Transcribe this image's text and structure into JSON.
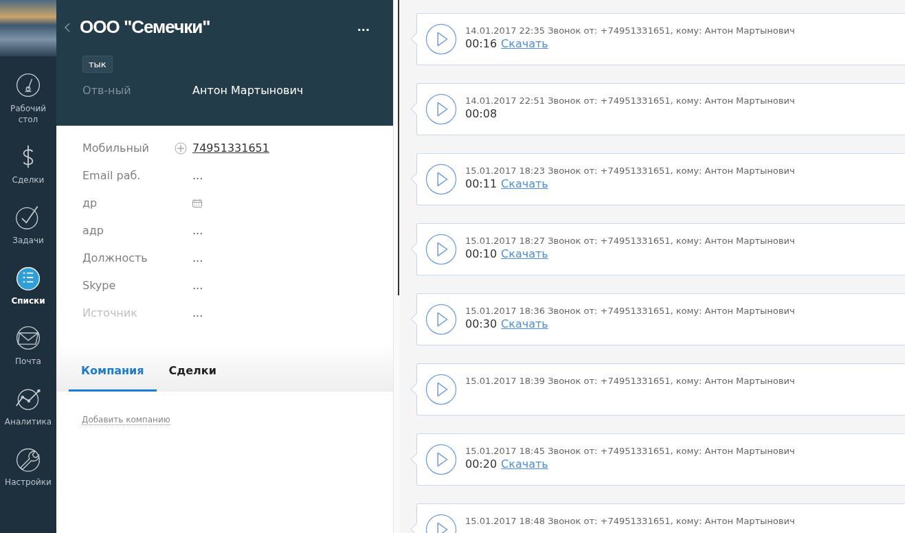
{
  "nav": [
    {
      "label": "Рабочий стол",
      "selected": false
    },
    {
      "label": "Сделки",
      "selected": false
    },
    {
      "label": "Задачи",
      "selected": false
    },
    {
      "label": "Списки",
      "selected": true
    },
    {
      "label": "Почта",
      "selected": false
    },
    {
      "label": "Аналитика",
      "selected": false
    },
    {
      "label": "Настройки",
      "selected": false
    }
  ],
  "card": {
    "title": "ООО \"Семечки\"",
    "more": "...",
    "tag": "тык",
    "owner_label": "Отв-ный",
    "owner": "Антон Мартынович",
    "fields": [
      {
        "kind": "phone",
        "label": "Мобильный",
        "value": "74951331651",
        "dim": false
      },
      {
        "kind": "text",
        "label": "Email раб.",
        "value": "...",
        "dim": false
      },
      {
        "kind": "date",
        "label": "др",
        "dim": false
      },
      {
        "kind": "text",
        "label": "адр",
        "value": "...",
        "dim": false
      },
      {
        "kind": "text",
        "label": "Должность",
        "value": "...",
        "dim": false
      },
      {
        "kind": "text",
        "label": "Skype",
        "value": "...",
        "dim": false
      },
      {
        "kind": "text",
        "label": "Источник",
        "value": "...",
        "dim": true
      }
    ],
    "tabs": [
      {
        "label": "Компания",
        "selected": true
      },
      {
        "label": "Сделки",
        "selected": false
      }
    ],
    "add_link": "Добавить компанию"
  },
  "calls": [
    {
      "header": "14.01.2017 22:35 Звонок от: +74951331651, кому: Антон Мартынович",
      "duration": "00:16",
      "link": "Скачать"
    },
    {
      "header": "14.01.2017 22:51 Звонок от: +74951331651, кому: Антон Мартынович",
      "duration": "00:08"
    },
    {
      "header": "15.01.2017 18:23 Звонок от: +74951331651, кому: Антон Мартынович",
      "duration": "00:11",
      "link": "Скачать"
    },
    {
      "header": "15.01.2017 18:27 Звонок от: +74951331651, кому: Антон Мартынович",
      "duration": "00:10",
      "link": "Скачать"
    },
    {
      "header": "15.01.2017 18:36 Звонок от: +74951331651, кому: Антон Мартынович",
      "duration": "00:30",
      "link": "Скачать"
    },
    {
      "header": "15.01.2017 18:39 Звонок от: +74951331651, кому: Антон Мартынович"
    },
    {
      "header": "15.01.2017 18:45 Звонок от: +74951331651, кому: Антон Мартынович",
      "duration": "00:20",
      "link": "Скачать"
    },
    {
      "header": "15.01.2017 18:48 Звонок от: +74951331651, кому: Антон Мартынович"
    }
  ]
}
